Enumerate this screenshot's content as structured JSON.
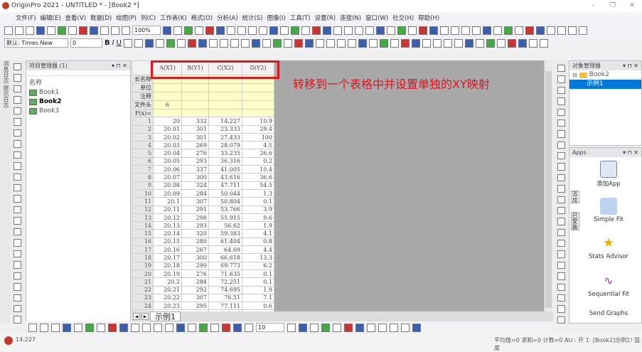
{
  "window": {
    "title": "OriginPro 2021 - UNTITLED * - [Book2 *]"
  },
  "menu": [
    "文件(F)",
    "编辑(E)",
    "查看(V)",
    "数据(D)",
    "绘图(P)",
    "列(C)",
    "工作表(K)",
    "格式(O)",
    "分析(A)",
    "统计(S)",
    "图像(I)",
    "工具(T)",
    "设置(R)",
    "连接(N)",
    "窗口(W)",
    "社交(H)",
    "帮助(H)"
  ],
  "toolbar": {
    "zoom": "100%",
    "font": "默认: Times New",
    "font_size": "0",
    "bottom_size": "10"
  },
  "left_tabs": "消息日志  提示日志",
  "project_explorer": {
    "title": "项目管理器 (1)",
    "column": "名称",
    "items": [
      {
        "label": "Book1",
        "active": false
      },
      {
        "label": "Book2",
        "active": true
      },
      {
        "label": "Book3",
        "active": false
      }
    ]
  },
  "worksheet": {
    "columns": [
      "A(X1)",
      "B(Y1)",
      "C(X2)",
      "D(Y2)"
    ],
    "label_rows": [
      {
        "label": "长名称",
        "values": [
          "",
          "",
          "",
          ""
        ]
      },
      {
        "label": "单位",
        "values": [
          "",
          "",
          "",
          ""
        ]
      },
      {
        "label": "注释",
        "values": [
          "",
          "",
          "",
          ""
        ]
      },
      {
        "label": "文件头",
        "values": [
          "6",
          "",
          "",
          ""
        ]
      },
      {
        "label": "F(x)=",
        "values": [
          "",
          "",
          "",
          ""
        ]
      }
    ],
    "rows": [
      [
        "20",
        "332",
        "14.227",
        "10.9"
      ],
      [
        "20.01",
        "301",
        "23.333",
        "29.4"
      ],
      [
        "20.02",
        "301",
        "27.433",
        "100"
      ],
      [
        "20.03",
        "269",
        "28.079",
        "4.5"
      ],
      [
        "20.04",
        "276",
        "33.235",
        "26.6"
      ],
      [
        "20.05",
        "293",
        "36.316",
        "0.2"
      ],
      [
        "20.06",
        "337",
        "41.005",
        "10.4"
      ],
      [
        "20.07",
        "300",
        "43.616",
        "36.6"
      ],
      [
        "20.08",
        "324",
        "47.711",
        "54.5"
      ],
      [
        "20.09",
        "284",
        "50.044",
        "1.3"
      ],
      [
        "20.1",
        "307",
        "50.804",
        "0.1"
      ],
      [
        "20.11",
        "291",
        "53.766",
        "3.9"
      ],
      [
        "20.12",
        "298",
        "55.915",
        "9.6"
      ],
      [
        "20.13",
        "293",
        "56.62",
        "1.9"
      ],
      [
        "20.14",
        "320",
        "59.383",
        "4.1"
      ],
      [
        "20.15",
        "280",
        "61.404",
        "0.8"
      ],
      [
        "20.16",
        "267",
        "64.69",
        "4.4"
      ],
      [
        "20.17",
        "300",
        "66.618",
        "13.3"
      ],
      [
        "20.18",
        "290",
        "69.773",
        "6.2"
      ],
      [
        "20.19",
        "276",
        "71.635",
        "0.1"
      ],
      [
        "20.2",
        "284",
        "72.251",
        "0.1"
      ],
      [
        "20.21",
        "292",
        "74.695",
        "1.9"
      ],
      [
        "20.22",
        "307",
        "76.51",
        "7.1"
      ],
      [
        "20.23",
        "295",
        "77.111",
        "0.6"
      ],
      [
        "20.24",
        "299",
        "79.504",
        "3.8"
      ]
    ],
    "sheet_tab": "示例1"
  },
  "annotation": "转移到一个表格中并设置单独的XY映射",
  "object_manager": {
    "title": "对象管理器",
    "book": "Book2",
    "sheet": "示例1"
  },
  "apps": {
    "title": "Apps",
    "side_tabs": [
      "添加",
      "已安装"
    ],
    "items": [
      "添加App",
      "Simple Fit",
      "Stats Advisor",
      "Sequential Fit",
      "Send Graphs"
    ]
  },
  "status": {
    "left": "14.227",
    "right": "平均值=0 求和=0 计数=0   AU : 开   1: [Book2]示例1! 弧度"
  },
  "colors": {
    "accent_red": "#e0141e",
    "selection": "#0078d7",
    "label_yellow": "#ffffcc"
  }
}
